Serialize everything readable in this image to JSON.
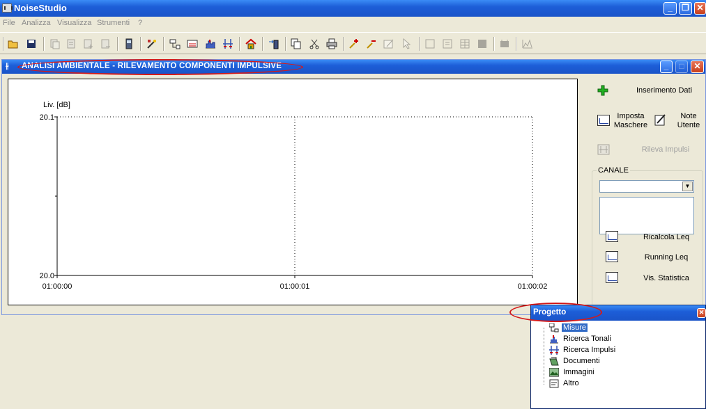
{
  "app": {
    "title": "NoiseStudio"
  },
  "menu": [
    "File",
    "Analizza",
    "Visualizza",
    "Strumenti",
    "?"
  ],
  "child_window": {
    "title": "ANALISI AMBIENTALE - RILEVAMENTO COMPONENTI IMPULSIVE"
  },
  "chart_data": {
    "type": "line",
    "title": "",
    "ylabel": "Liv. [dB]",
    "xlabel": "",
    "ylim": [
      20.0,
      20.1
    ],
    "y_tick_labels": [
      "20.1",
      "20.0"
    ],
    "x_tick_labels": [
      "01:00:00",
      "01:00:01",
      "01:00:02"
    ],
    "grid": "dotted",
    "series": []
  },
  "side_panel": {
    "inserimento_dati": "Inserimento Dati",
    "imposta_maschere_1": "Imposta",
    "imposta_maschere_2": "Maschere",
    "note_utente_1": "Note",
    "note_utente_2": "Utente",
    "rileva_impulsi": "Rileva Impulsi",
    "canale_label": "CANALE",
    "canale_value": "",
    "ricalcola_leq": "Ricalcola Leq",
    "running_leq": "Running Leq",
    "vis_statistica": "Vis. Statistica"
  },
  "project_panel": {
    "title": "Progetto",
    "items": [
      "Misure",
      "Ricerca Tonali",
      "Ricerca Impulsi",
      "Documenti",
      "Immagini",
      "Altro"
    ]
  },
  "colors": {
    "titlebar": "#1d5ed8",
    "highlight": "#d41a1a",
    "selection": "#316ac5"
  }
}
